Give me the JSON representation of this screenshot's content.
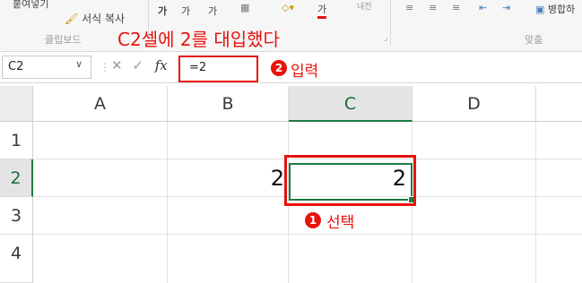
{
  "ribbon": {
    "top_cut_label": "붙여넣기",
    "format_painter_label": "서식 복사",
    "clipboard_group": "클립보드",
    "font_buttons": [
      "가",
      "가",
      "가",
      "가"
    ],
    "wrap_label": "내전",
    "merge_label": "병합하",
    "align_group": "맞춤"
  },
  "annotations": {
    "title": "C2셀에 2를 대입했다",
    "step2_badge": "2",
    "step2_text": "입력",
    "step1_badge": "1",
    "step1_text": "선택"
  },
  "formula_bar": {
    "name_box": "C2",
    "cancel_icon": "✕",
    "enter_icon": "✓",
    "fx_label": "fx",
    "formula": "=2"
  },
  "sheet": {
    "columns": [
      "A",
      "B",
      "C",
      "D"
    ],
    "rows": [
      "1",
      "2",
      "3",
      "4"
    ],
    "cells": {
      "B2": "2",
      "C2": "2"
    },
    "selected_cell": "C2"
  },
  "colors": {
    "accent_green": "#1f7a43",
    "annotation_red": "#e8120c"
  }
}
